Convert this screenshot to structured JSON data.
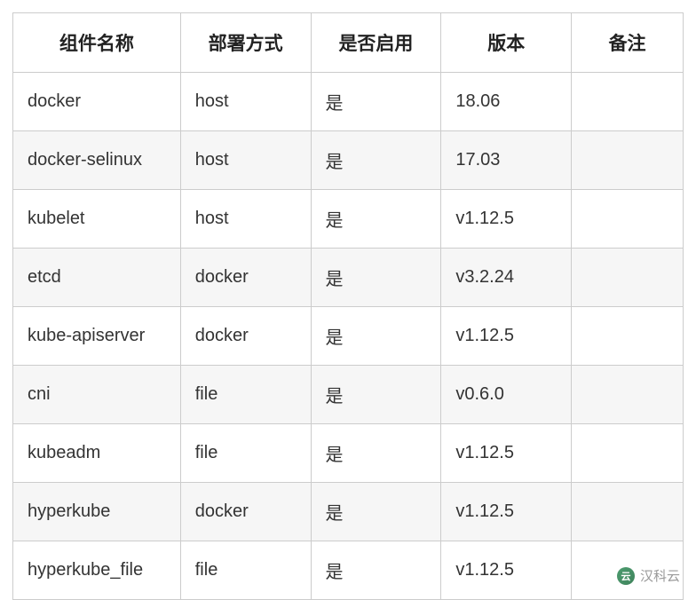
{
  "chart_data": {
    "type": "table",
    "headers": [
      "组件名称",
      "部署方式",
      "是否启用",
      "版本",
      "备注"
    ],
    "rows": [
      {
        "name": "docker",
        "deploy": "host",
        "enabled": "是",
        "version": "18.06",
        "note": ""
      },
      {
        "name": "docker-selinux",
        "deploy": "host",
        "enabled": "是",
        "version": "17.03",
        "note": ""
      },
      {
        "name": "kubelet",
        "deploy": "host",
        "enabled": "是",
        "version": "v1.12.5",
        "note": ""
      },
      {
        "name": "etcd",
        "deploy": "docker",
        "enabled": "是",
        "version": "v3.2.24",
        "note": ""
      },
      {
        "name": "kube-apiserver",
        "deploy": "docker",
        "enabled": "是",
        "version": "v1.12.5",
        "note": ""
      },
      {
        "name": "cni",
        "deploy": "file",
        "enabled": "是",
        "version": "v0.6.0",
        "note": ""
      },
      {
        "name": "kubeadm",
        "deploy": "file",
        "enabled": "是",
        "version": "v1.12.5",
        "note": ""
      },
      {
        "name": "hyperkube",
        "deploy": "docker",
        "enabled": "是",
        "version": "v1.12.5",
        "note": ""
      },
      {
        "name": "hyperkube_file",
        "deploy": "file",
        "enabled": "是",
        "version": "v1.12.5",
        "note": ""
      }
    ]
  },
  "watermark": {
    "icon_label": "云",
    "text": "汉科云"
  }
}
